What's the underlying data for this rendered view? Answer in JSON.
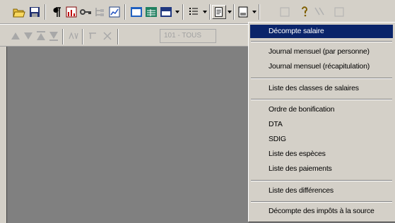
{
  "toolbar2": {
    "combo_value": "101 - TOUS"
  },
  "menu": {
    "items": [
      {
        "label": "Décompte salaire",
        "selected": true
      },
      {
        "label": "Journal mensuel (par personne)"
      },
      {
        "label": "Journal mensuel (récapitulation)"
      },
      {
        "label": "Liste des classes de salaires"
      },
      {
        "label": "Ordre de bonification"
      },
      {
        "label": "DTA"
      },
      {
        "label": "SDIG"
      },
      {
        "label": "Liste des espèces"
      },
      {
        "label": "Liste des paiements"
      },
      {
        "label": "Liste des différences"
      },
      {
        "label": "Décompte des impôts à la source"
      }
    ]
  },
  "colors": {
    "face": "#d4d0c8",
    "workspace": "#808080",
    "highlight": "#0a246a"
  }
}
